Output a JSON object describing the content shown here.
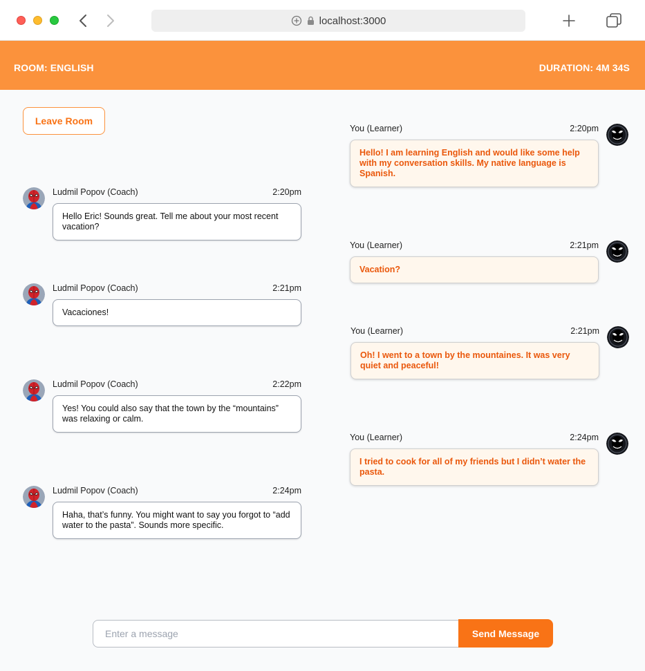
{
  "browser": {
    "url": "localhost:3000"
  },
  "header": {
    "room": "ROOM: ENGLISH",
    "duration": "DURATION: 4M 34S",
    "accent_color": "#fb923c"
  },
  "actions": {
    "leave_label": "Leave Room"
  },
  "messages": {
    "coach": [
      {
        "name": "Ludmil Popov (Coach)",
        "time": "2:20pm",
        "text": "Hello Eric! Sounds great. Tell me about your most recent vacation?"
      },
      {
        "name": "Ludmil Popov (Coach)",
        "time": "2:21pm",
        "text": "Vacaciones!"
      },
      {
        "name": "Ludmil Popov (Coach)",
        "time": "2:22pm",
        "text": "Yes! You could also say that the town by the “mountains” was relaxing or calm."
      },
      {
        "name": "Ludmil Popov (Coach)",
        "time": "2:24pm",
        "text": "Haha, that’s funny. You might want to say you forgot to “add water to the pasta”. Sounds more specific."
      }
    ],
    "learner": [
      {
        "name": "You (Learner)",
        "time": "2:20pm",
        "text": "Hello! I am learning English and would like some help with my conversation skills. My native language is Spanish."
      },
      {
        "name": "You (Learner)",
        "time": "2:21pm",
        "text": "Vacation?"
      },
      {
        "name": "You (Learner)",
        "time": "2:21pm",
        "text": "Oh! I went to a town by the mountaines. It was very quiet and peaceful!"
      },
      {
        "name": "You (Learner)",
        "time": "2:24pm",
        "text": "I tried to cook for all of my friends but I didn’t water the pasta."
      }
    ]
  },
  "composer": {
    "placeholder": "Enter a message",
    "value": "",
    "send_label": "Send Message",
    "send_color": "#f97316"
  },
  "icons": {
    "coach_avatar": "spiderman-avatar-icon",
    "learner_avatar": "venom-avatar-icon"
  }
}
